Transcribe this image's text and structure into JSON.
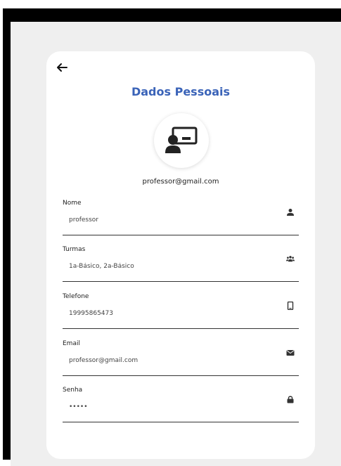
{
  "page": {
    "title": "Dados Pessoais",
    "email_header": "professor@gmail.com"
  },
  "fields": [
    {
      "label": "Nome",
      "value": "professor",
      "icon": "user-icon"
    },
    {
      "label": "Turmas",
      "value": "1a-Básico, 2a-Básico",
      "icon": "users-icon"
    },
    {
      "label": "Telefone",
      "value": "19995865473",
      "icon": "phone-icon"
    },
    {
      "label": "Email",
      "value": "professor@gmail.com",
      "icon": "envelope-icon"
    },
    {
      "label": "Senha",
      "value": "•••••",
      "icon": "lock-icon"
    }
  ],
  "colors": {
    "title": "#3a63b8",
    "background": "#efefef",
    "card": "#ffffff"
  }
}
